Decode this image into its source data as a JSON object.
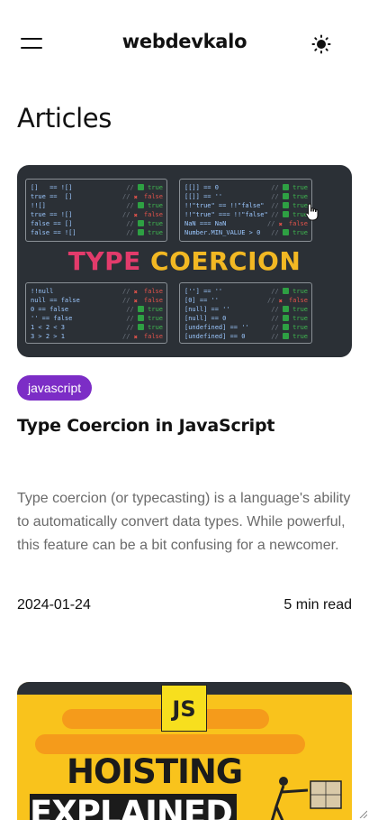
{
  "header": {
    "site_title": "webdevkalo",
    "menu_icon": "hamburger-menu-icon",
    "theme_icon": "sun-icon"
  },
  "page": {
    "heading": "Articles"
  },
  "articles": [
    {
      "tag": "javascript",
      "title": "Type Coercion in JavaScript",
      "excerpt": "Type coercion (or typecasting) is a language's ability to automatically convert data types. While powerful, this feature can be a bit confusing for a newcomer.",
      "date": "2024-01-24",
      "read_time": "5 min read",
      "image": {
        "title_part1": "TYPE",
        "title_part2": "COERCION",
        "box1": [
          {
            "code": "[]   == ![]",
            "result": "true",
            "ok": true
          },
          {
            "code": "true ==  []",
            "result": "false",
            "ok": false
          },
          {
            "code": "!![]",
            "result": "true",
            "ok": true
          },
          {
            "code": "true == ![]",
            "result": "false",
            "ok": false
          },
          {
            "code": "false == []",
            "result": "true",
            "ok": true
          },
          {
            "code": "false == ![]",
            "result": "true",
            "ok": true
          }
        ],
        "box2": [
          {
            "code": "[[]] == 0",
            "result": "true",
            "ok": true
          },
          {
            "code": "[[]] == ''",
            "result": "true",
            "ok": true
          },
          {
            "code": "!!\"true\" == !!\"false\"",
            "result": "true",
            "ok": true
          },
          {
            "code": "!!\"true\" === !!\"false\"",
            "result": "true",
            "ok": true
          },
          {
            "code": "NaN === NaN",
            "result": "false",
            "ok": false
          },
          {
            "code": "Number.MIN_VALUE > 0",
            "result": "true",
            "ok": true
          }
        ],
        "box3": [
          {
            "code": "!!null",
            "result": "false",
            "ok": false
          },
          {
            "code": "null == false",
            "result": "false",
            "ok": false
          },
          {
            "code": "0 == false",
            "result": "true",
            "ok": true
          },
          {
            "code": "'' == false",
            "result": "true",
            "ok": true
          },
          {
            "code": "1 < 2 < 3",
            "result": "true",
            "ok": true
          },
          {
            "code": "3 > 2 > 1",
            "result": "false",
            "ok": false
          }
        ],
        "box4": [
          {
            "code": "[''] == ''",
            "result": "true",
            "ok": true
          },
          {
            "code": "[0] == ''",
            "result": "false",
            "ok": false
          },
          {
            "code": "[null] == ''",
            "result": "true",
            "ok": true
          },
          {
            "code": "[null] == 0",
            "result": "true",
            "ok": true
          },
          {
            "code": "[undefined] == ''",
            "result": "true",
            "ok": true
          },
          {
            "code": "[undefined] == 0",
            "result": "true",
            "ok": true
          }
        ]
      }
    },
    {
      "image": {
        "badge": "JS",
        "line1": "HOISTING",
        "line2": "EXPLAINED"
      }
    }
  ],
  "colors": {
    "tag_bg": "#7c2dc6",
    "coercion_pink": "#e23b6b",
    "coercion_yellow": "#f2b823",
    "hoisting_yellow": "#f9c31c",
    "hoisting_orange": "#f59b1b"
  }
}
